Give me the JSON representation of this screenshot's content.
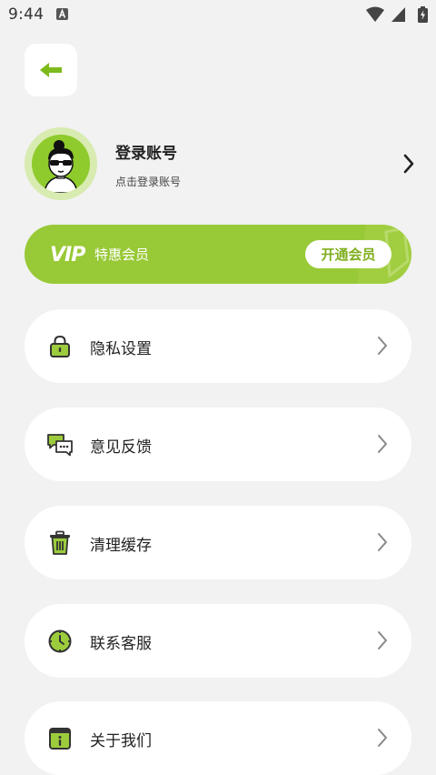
{
  "status_bar": {
    "time": "9:44"
  },
  "profile": {
    "name": "登录账号",
    "subtitle": "点击登录账号"
  },
  "vip": {
    "logo": "VIP",
    "label": "特惠会员",
    "button": "开通会员"
  },
  "menu": {
    "items": [
      {
        "label": "隐私设置",
        "icon": "lock-icon"
      },
      {
        "label": "意见反馈",
        "icon": "chat-bubbles-icon"
      },
      {
        "label": "清理缓存",
        "icon": "trash-icon"
      },
      {
        "label": "联系客服",
        "icon": "headset-icon"
      },
      {
        "label": "关于我们",
        "icon": "info-icon"
      }
    ]
  },
  "colors": {
    "accent": "#98c936",
    "accent_dark": "#6fa71e",
    "background": "#f1f2f1"
  }
}
